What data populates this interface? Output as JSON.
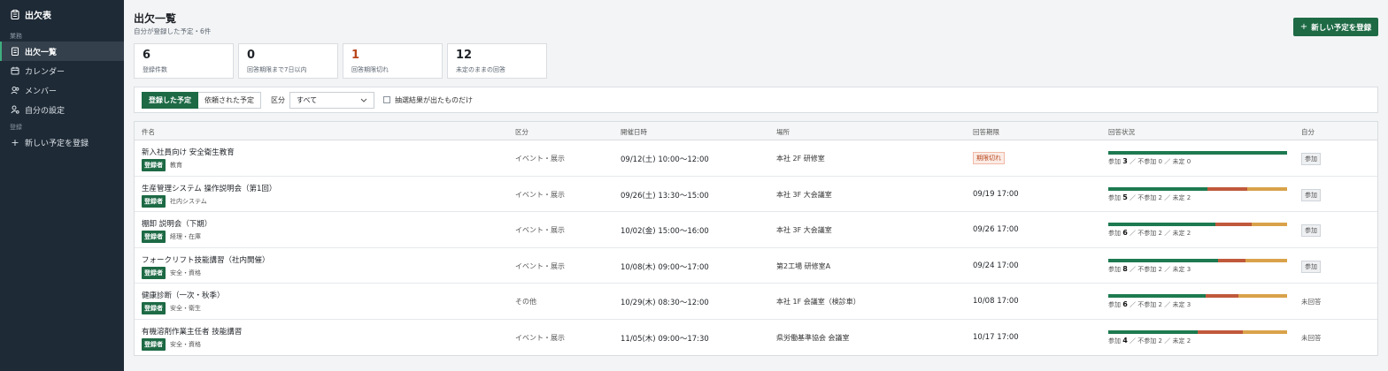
{
  "app": {
    "title": "出欠表"
  },
  "sidebar": {
    "section_work": "業務",
    "section_register": "登録",
    "items": [
      {
        "label": "出欠一覧",
        "icon": "clipboard-icon",
        "active": true
      },
      {
        "label": "カレンダー",
        "icon": "calendar-icon"
      },
      {
        "label": "メンバー",
        "icon": "users-icon"
      },
      {
        "label": "自分の設定",
        "icon": "user-settings-icon"
      }
    ],
    "new_label": "新しい予定を登録"
  },
  "header": {
    "title": "出欠一覧",
    "subtitle": "自分が登録した予定・6件",
    "new_button": "新しい予定を登録"
  },
  "stats": [
    {
      "value": "6",
      "label": "登録件数"
    },
    {
      "value": "0",
      "label": "回答期限まで7日以内"
    },
    {
      "value": "1",
      "label": "回答期限切れ"
    },
    {
      "value": "12",
      "label": "未定のままの回答"
    }
  ],
  "filter": {
    "tab_registered": "登録した予定",
    "tab_requested": "依頼された予定",
    "category_label": "区分",
    "category_value": "すべて",
    "checkbox_label": "抽選結果が出たものだけ"
  },
  "table": {
    "headers": {
      "name": "件名",
      "category": "区分",
      "datetime": "開催日時",
      "place": "場所",
      "deadline": "回答期限",
      "status": "回答状況",
      "self": "自分"
    },
    "rows": [
      {
        "name": "新入社員向け 安全衛生教育",
        "badge": "登録者",
        "tag": "教育",
        "category": "イベント・展示",
        "datetime": "09/12(土) 10:00〜12:00",
        "place": "本社 2F 研修室",
        "deadline": "期限切れ",
        "attend": "3",
        "absent": "0",
        "undecided": "0",
        "self": "参加"
      },
      {
        "name": "生産管理システム 操作説明会（第1回）",
        "badge": "登録者",
        "tag": "社内システム",
        "category": "イベント・展示",
        "datetime": "09/26(土) 13:30〜15:00",
        "place": "本社 3F 大会議室",
        "deadline": "09/19 17:00",
        "attend": "5",
        "absent": "2",
        "undecided": "2",
        "self": "参加"
      },
      {
        "name": "棚卸 説明会（下期）",
        "badge": "登録者",
        "tag": "経理・在庫",
        "category": "イベント・展示",
        "datetime": "10/02(金) 15:00〜16:00",
        "place": "本社 3F 大会議室",
        "deadline": "09/26 17:00",
        "attend": "6",
        "absent": "2",
        "undecided": "2",
        "self": "参加"
      },
      {
        "name": "フォークリフト技能講習（社内開催）",
        "badge": "登録者",
        "tag": "安全・資格",
        "category": "イベント・展示",
        "datetime": "10/08(木) 09:00〜17:00",
        "place": "第2工場 研修室A",
        "deadline": "09/24 17:00",
        "attend": "8",
        "absent": "2",
        "undecided": "3",
        "self": "参加"
      },
      {
        "name": "健康診断（一次・秋季）",
        "badge": "登録者",
        "tag": "安全・衛生",
        "category": "その他",
        "datetime": "10/29(木) 08:30〜12:00",
        "place": "本社 1F 会議室（検診車）",
        "deadline": "10/08 17:00",
        "attend": "6",
        "absent": "2",
        "undecided": "3",
        "self": "未回答"
      },
      {
        "name": "有機溶剤作業主任者 技能講習",
        "badge": "登録者",
        "tag": "安全・資格",
        "category": "イベント・展示",
        "datetime": "11/05(木) 09:00〜17:30",
        "place": "県労働基準協会 会議室",
        "deadline": "10/17 17:00",
        "attend": "4",
        "absent": "2",
        "undecided": "2",
        "self": "未回答"
      }
    ],
    "labels": {
      "attend": "参加",
      "absent": "不参加",
      "undecided": "未定",
      "sep": "／"
    }
  },
  "colors": {
    "accent": "#1d6a45",
    "sidebar": "#1e2a36",
    "alert": "#b8461c",
    "bar_attend": "#1d7a50",
    "bar_absent": "#c0593b",
    "bar_undecided": "#d9a24a"
  }
}
